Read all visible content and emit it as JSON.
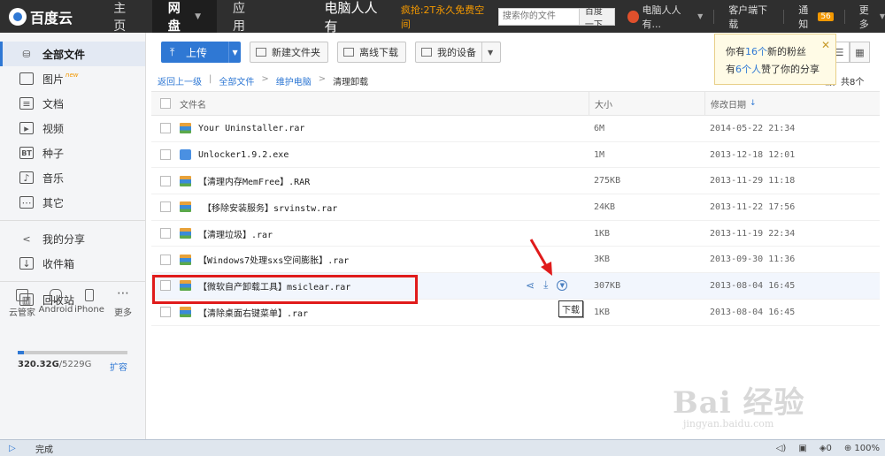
{
  "header": {
    "logo": "百度云",
    "nav": [
      {
        "label": "主页"
      },
      {
        "label": "网盘"
      },
      {
        "label": "应用"
      }
    ],
    "brand_text": "电脑人人有",
    "promo": "疯抢:2T永久免费空间",
    "search_placeholder": "搜索你的文件",
    "search_button": "百度一下",
    "user_name": "电脑人人有...",
    "client_download": "客户端下载",
    "notify_label": "通知",
    "notify_count": "56",
    "more_label": "更多"
  },
  "sidebar": {
    "items": [
      {
        "label": "全部文件",
        "icon": "folder-icon"
      },
      {
        "label": "图片",
        "icon": "image-icon",
        "tag": "new"
      },
      {
        "label": "文档",
        "icon": "document-icon"
      },
      {
        "label": "视频",
        "icon": "video-icon"
      },
      {
        "label": "种子",
        "icon": "torrent-icon",
        "icon_text": "BT"
      },
      {
        "label": "音乐",
        "icon": "music-icon"
      },
      {
        "label": "其它",
        "icon": "other-icon"
      },
      {
        "label": "我的分享",
        "icon": "share-icon"
      },
      {
        "label": "收件箱",
        "icon": "inbox-icon"
      },
      {
        "label": "回收站",
        "icon": "trash-icon"
      }
    ],
    "devices": [
      {
        "label": "云管家"
      },
      {
        "label": "Android"
      },
      {
        "label": "iPhone"
      },
      {
        "label": "更多"
      }
    ],
    "quota_used": "320.32G",
    "quota_total": "/5229G",
    "quota_fraction": 0.06,
    "expand_label": "扩容"
  },
  "toolbar": {
    "upload": "上传",
    "new_folder": "新建文件夹",
    "offline_download": "离线下载",
    "my_devices": "我的设备"
  },
  "popup": {
    "line1_pre": "你有",
    "line1_em": "16个",
    "line1_post": "新的粉丝",
    "line2_pre": "有",
    "line2_em": "6个人",
    "line2_post": "赞了你的分享"
  },
  "breadcrumb": {
    "back": "返回上一级",
    "all_files": "全部文件",
    "parent": "维护电脑",
    "current": "清理卸载",
    "count_text": "载，共8个"
  },
  "table": {
    "headers": {
      "name": "文件名",
      "size": "大小",
      "date": "修改日期"
    },
    "rows": [
      {
        "name": "Your Uninstaller.rar",
        "size": "6M",
        "date": "2014-05-22 21:34",
        "type": "rar"
      },
      {
        "name": "Unlocker1.9.2.exe",
        "size": "1M",
        "date": "2013-12-18 12:01",
        "type": "exe"
      },
      {
        "name": "【清理内存MemFree】.RAR",
        "size": "275KB",
        "date": "2013-11-29 11:18",
        "type": "rar"
      },
      {
        "name": "　【移除安装服务】srvinstw.rar",
        "size": "24KB",
        "date": "2013-11-22 17:56",
        "type": "rar"
      },
      {
        "name": "【清理垃圾】.rar",
        "size": "1KB",
        "date": "2013-11-19 22:34",
        "type": "rar"
      },
      {
        "name": "【Windows7处理sxs空间膨胀】.rar",
        "size": "3KB",
        "date": "2013-09-30 11:36",
        "type": "rar"
      },
      {
        "name": "【微软自产卸载工具】msiclear.rar",
        "size": "307KB",
        "date": "2013-08-04 16:45",
        "type": "rar"
      },
      {
        "name": "【清除桌面右键菜单】.rar",
        "size": "1KB",
        "date": "2013-08-04 16:45",
        "type": "rar"
      }
    ],
    "download_tooltip": "下载"
  },
  "watermark": {
    "big": "Bai 经验",
    "small": "jingyan.baidu.com"
  },
  "statusbar": {
    "status": "完成",
    "zoom": "100%"
  },
  "colors": {
    "accent": "#2f78d4",
    "topbar": "#2f2f2f",
    "annotation": "#e01b1b",
    "promo": "#f39800"
  }
}
